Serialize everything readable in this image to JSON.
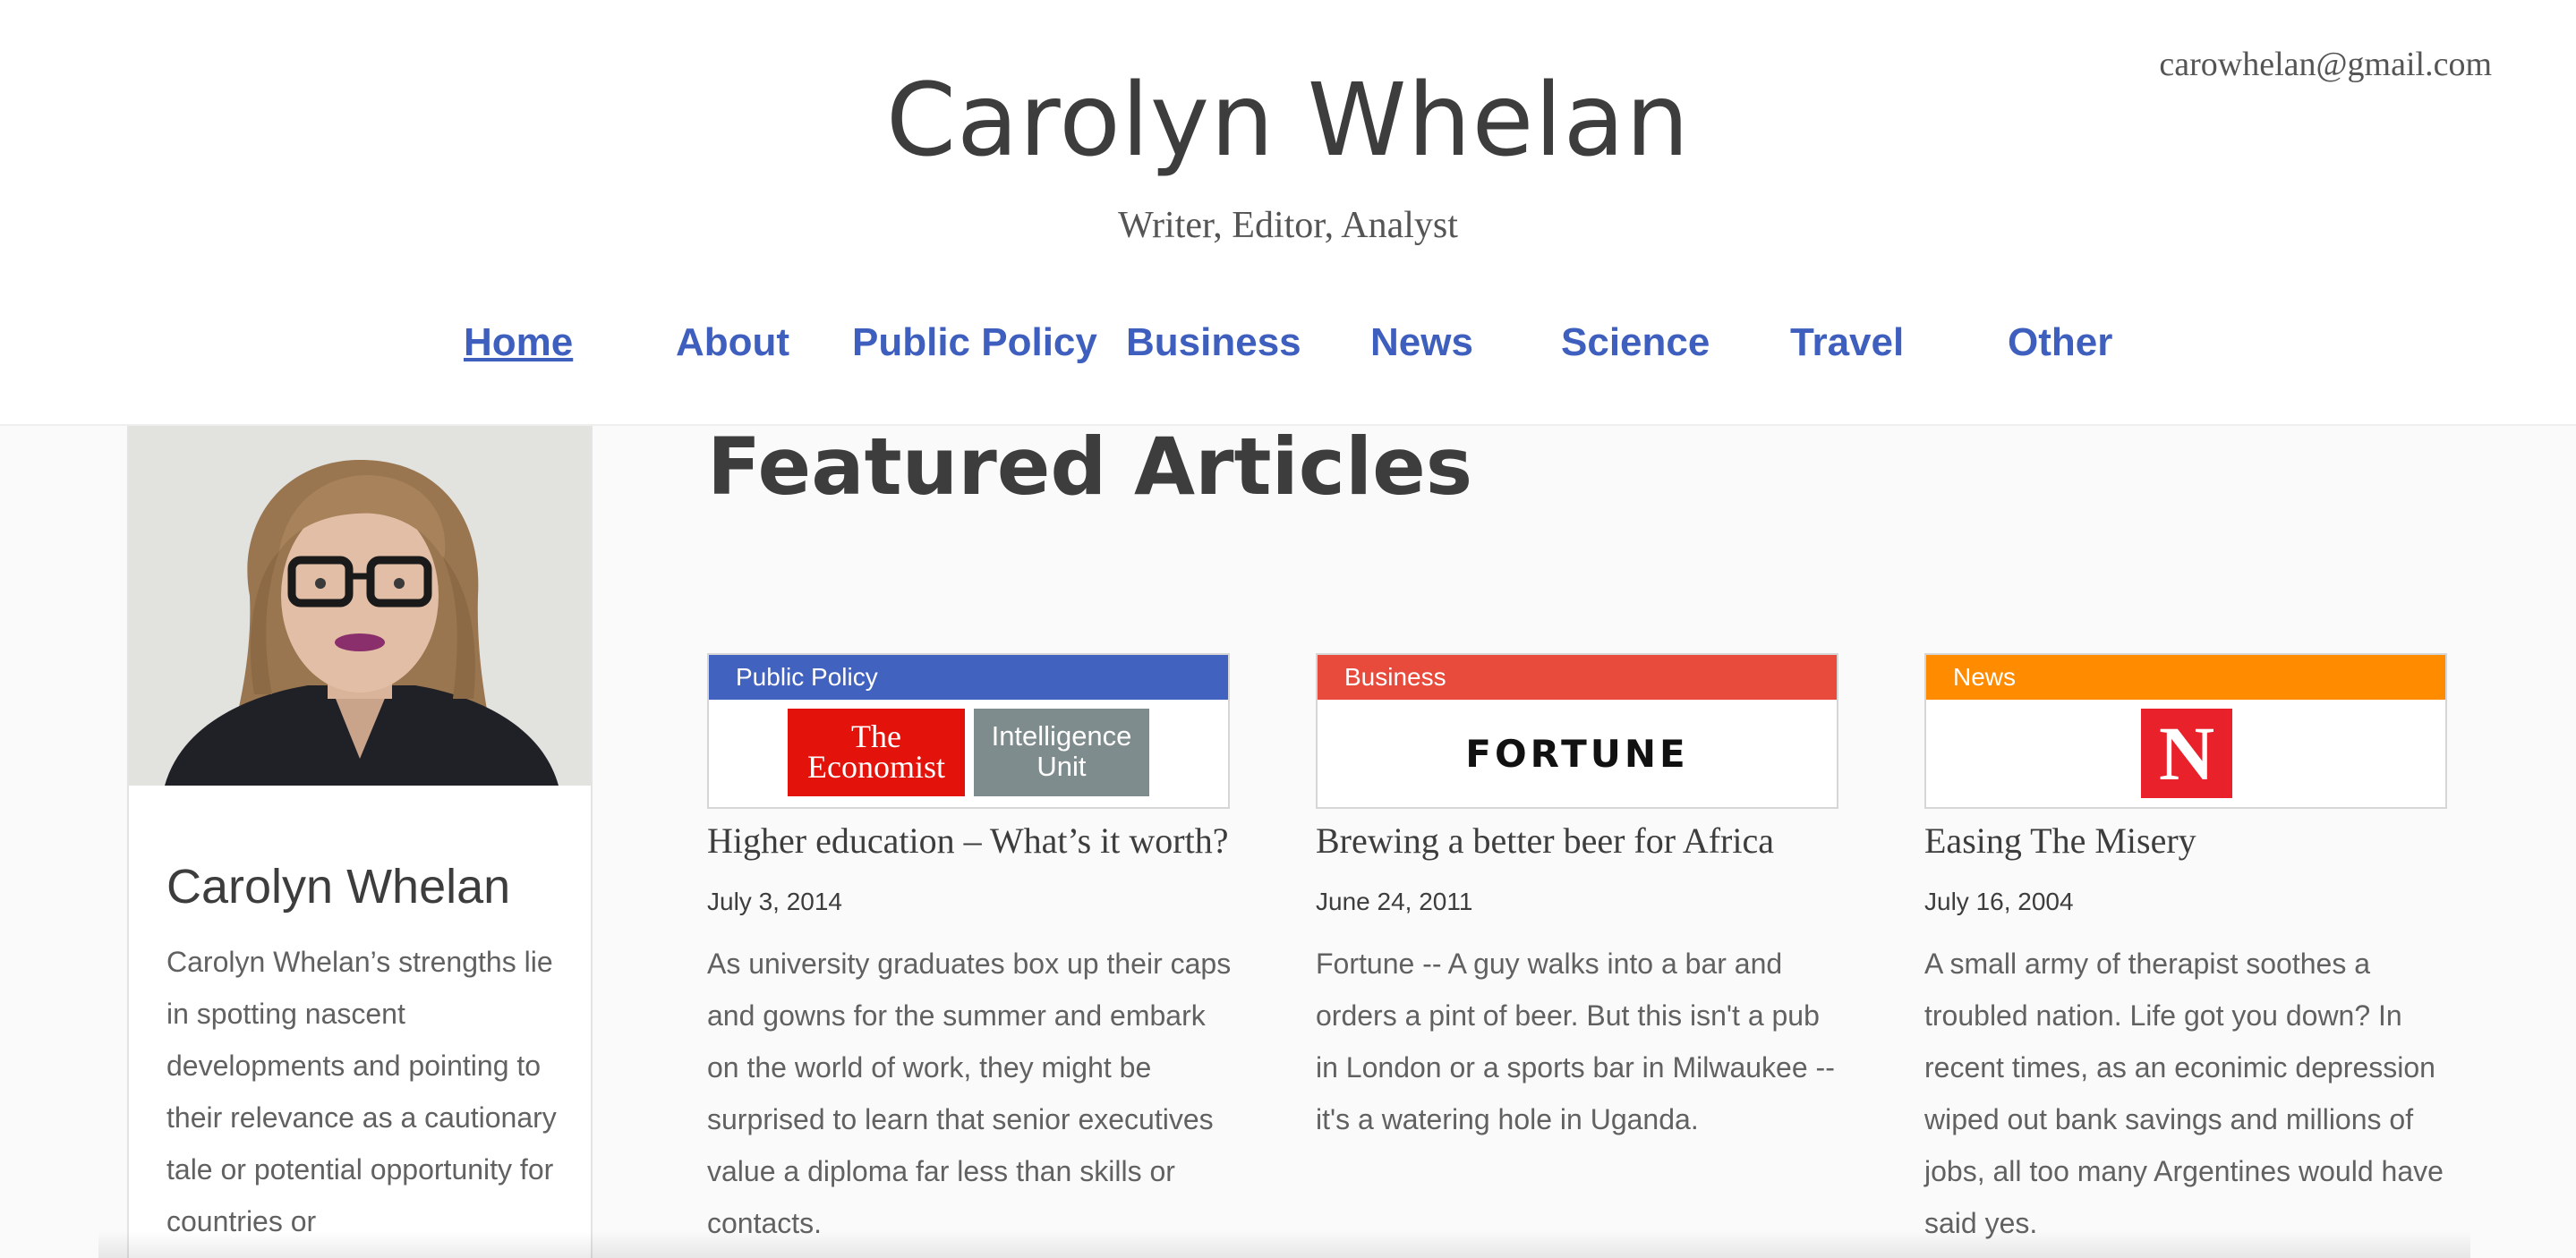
{
  "site": {
    "title": "Carolyn Whelan",
    "tagline": "Writer, Editor, Analyst",
    "email": "carowhelan@gmail.com"
  },
  "nav": {
    "items": [
      {
        "label": "Home",
        "active": true
      },
      {
        "label": "About"
      },
      {
        "label": "Public Policy"
      },
      {
        "label": "Business"
      },
      {
        "label": "News"
      },
      {
        "label": "Science"
      },
      {
        "label": "Travel"
      },
      {
        "label": "Other"
      }
    ]
  },
  "sidebar": {
    "name": "Carolyn Whelan",
    "bio": "Carolyn Whelan’s strengths lie in spotting nascent developments and pointing to their relevance as a cautionary tale or potential opportunity for countries or"
  },
  "featured": {
    "heading": "Featured Articles",
    "articles": [
      {
        "category": "Public Policy",
        "category_color": "#4262bf",
        "logo_line1": "The",
        "logo_line2": "Economist",
        "logo_sub_line1": "Intelligence",
        "logo_sub_line2": "Unit",
        "title": "Higher education – What’s it worth?",
        "date": "July 3, 2014",
        "excerpt": "As university graduates box up their caps and gowns for the summer and embark on the world of work, they might be surprised to learn that senior executives value a diploma far less than skills or contacts."
      },
      {
        "category": "Business",
        "category_color": "#e84a3b",
        "logo_text": "FORTUNE",
        "title": "Brewing a better beer for Africa",
        "date": "June 24, 2011",
        "excerpt": "Fortune -- A guy walks into a bar and orders a pint of beer. But this isn't a pub in London or a sports bar in Milwaukee -- it's a watering hole in Uganda."
      },
      {
        "category": "News",
        "category_color": "#ff8c00",
        "logo_text": "N",
        "title": "Easing The Misery",
        "date": "July 16, 2004",
        "excerpt": "A small army of therapist soothes a troubled nation. Life got you down? In recent times, as an econimic depression wiped out bank savings and millions of jobs, all too many Argentines would have said yes."
      }
    ]
  }
}
